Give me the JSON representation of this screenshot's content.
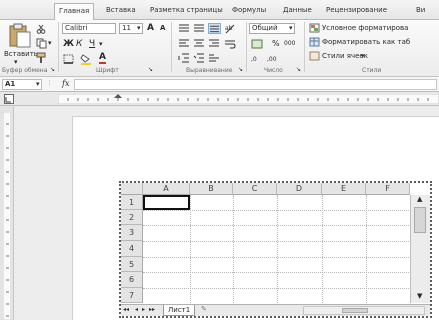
{
  "tabs": [
    "Главная",
    "Вставка",
    "Разметка страницы",
    "Формулы",
    "Данные",
    "Рецензирование",
    "Ви"
  ],
  "clipboard": {
    "paste_label": "Вставить",
    "group_label": "Буфер обмена"
  },
  "font": {
    "name": "Calibri",
    "size": "11",
    "bold": "Ж",
    "italic": "К",
    "underline": "Ч",
    "grow": "A",
    "shrink": "A",
    "color_glyph": "A",
    "group_label": "Шрифт"
  },
  "alignment": {
    "group_label": "Выравнивание"
  },
  "number": {
    "format": "Общий",
    "percent": "%",
    "thousands": "000",
    "group_label": "Число"
  },
  "styles": {
    "conditional": "Условное форматирова",
    "format_table": "Форматировать как таб",
    "cell_styles": "Стили ячеек",
    "group_label": "Стили"
  },
  "formula_bar": {
    "cell_ref": "A1",
    "fx": "fx",
    "value": ""
  },
  "sheet": {
    "columns": [
      "A",
      "B",
      "C",
      "D",
      "E",
      "F"
    ],
    "rows": [
      "1",
      "2",
      "3",
      "4",
      "5",
      "6",
      "7"
    ],
    "tab_label": "Лист1"
  }
}
